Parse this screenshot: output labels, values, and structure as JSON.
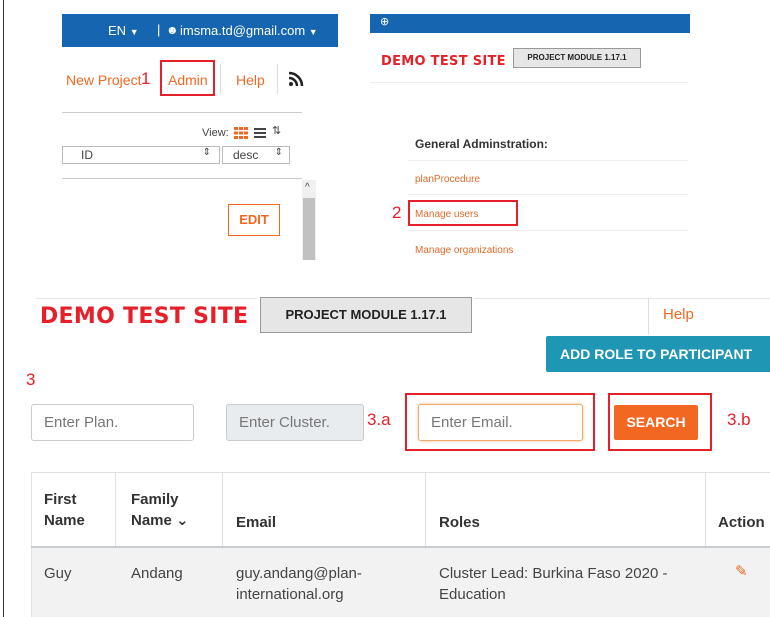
{
  "top_left": {
    "lang": "EN",
    "lang_caret": "▼",
    "separator": "|",
    "email": "imsma.td@gmail.com",
    "email_caret": "▼",
    "menu": {
      "new_project": "New Project",
      "admin": "Admin",
      "help": "Help"
    },
    "view_label": "View:",
    "sort_field": "ID",
    "sort_order": "desc",
    "edit_button": "EDIT",
    "scroll_up": "^"
  },
  "top_right": {
    "un_logo": "⊕",
    "site_title": "DEMO TEST SITE",
    "module_button": "PROJECT MODULE 1.17.1",
    "section_heading": "General Adminstration:",
    "links": [
      "planProcedure",
      "Manage users",
      "Manage organizations"
    ]
  },
  "annotations": {
    "n1": "1",
    "n2": "2",
    "n3": "3",
    "n3a": "3.a",
    "n3b": "3.b"
  },
  "main": {
    "site_title": "DEMO TEST SITE",
    "module_button": "PROJECT MODULE 1.17.1",
    "help": "Help",
    "add_role_button": "ADD ROLE TO PARTICIPANT",
    "filters": {
      "plan_placeholder": "Enter Plan.",
      "cluster_placeholder": "Enter Cluster.",
      "email_placeholder": "Enter Email.",
      "search_button": "SEARCH"
    },
    "table": {
      "headers": {
        "first_name_1": "First",
        "first_name_2": "Name",
        "family_name_1": "Family",
        "family_name_2": "Name ⌄",
        "email": "Email",
        "roles": "Roles",
        "action": "Action"
      },
      "rows": [
        {
          "first_name": "Guy",
          "family_name": "Andang",
          "email_1": "guy.andang@plan-",
          "email_2": "international.org",
          "roles_1": "Cluster Lead: Burkina Faso 2020 -",
          "roles_2": "Education",
          "action_icon": "✎"
        }
      ]
    }
  },
  "colors": {
    "accent_red": "#e5202a",
    "brand_blue": "#1565b0",
    "search_orange": "#f26722",
    "teal": "#1e96b4"
  }
}
